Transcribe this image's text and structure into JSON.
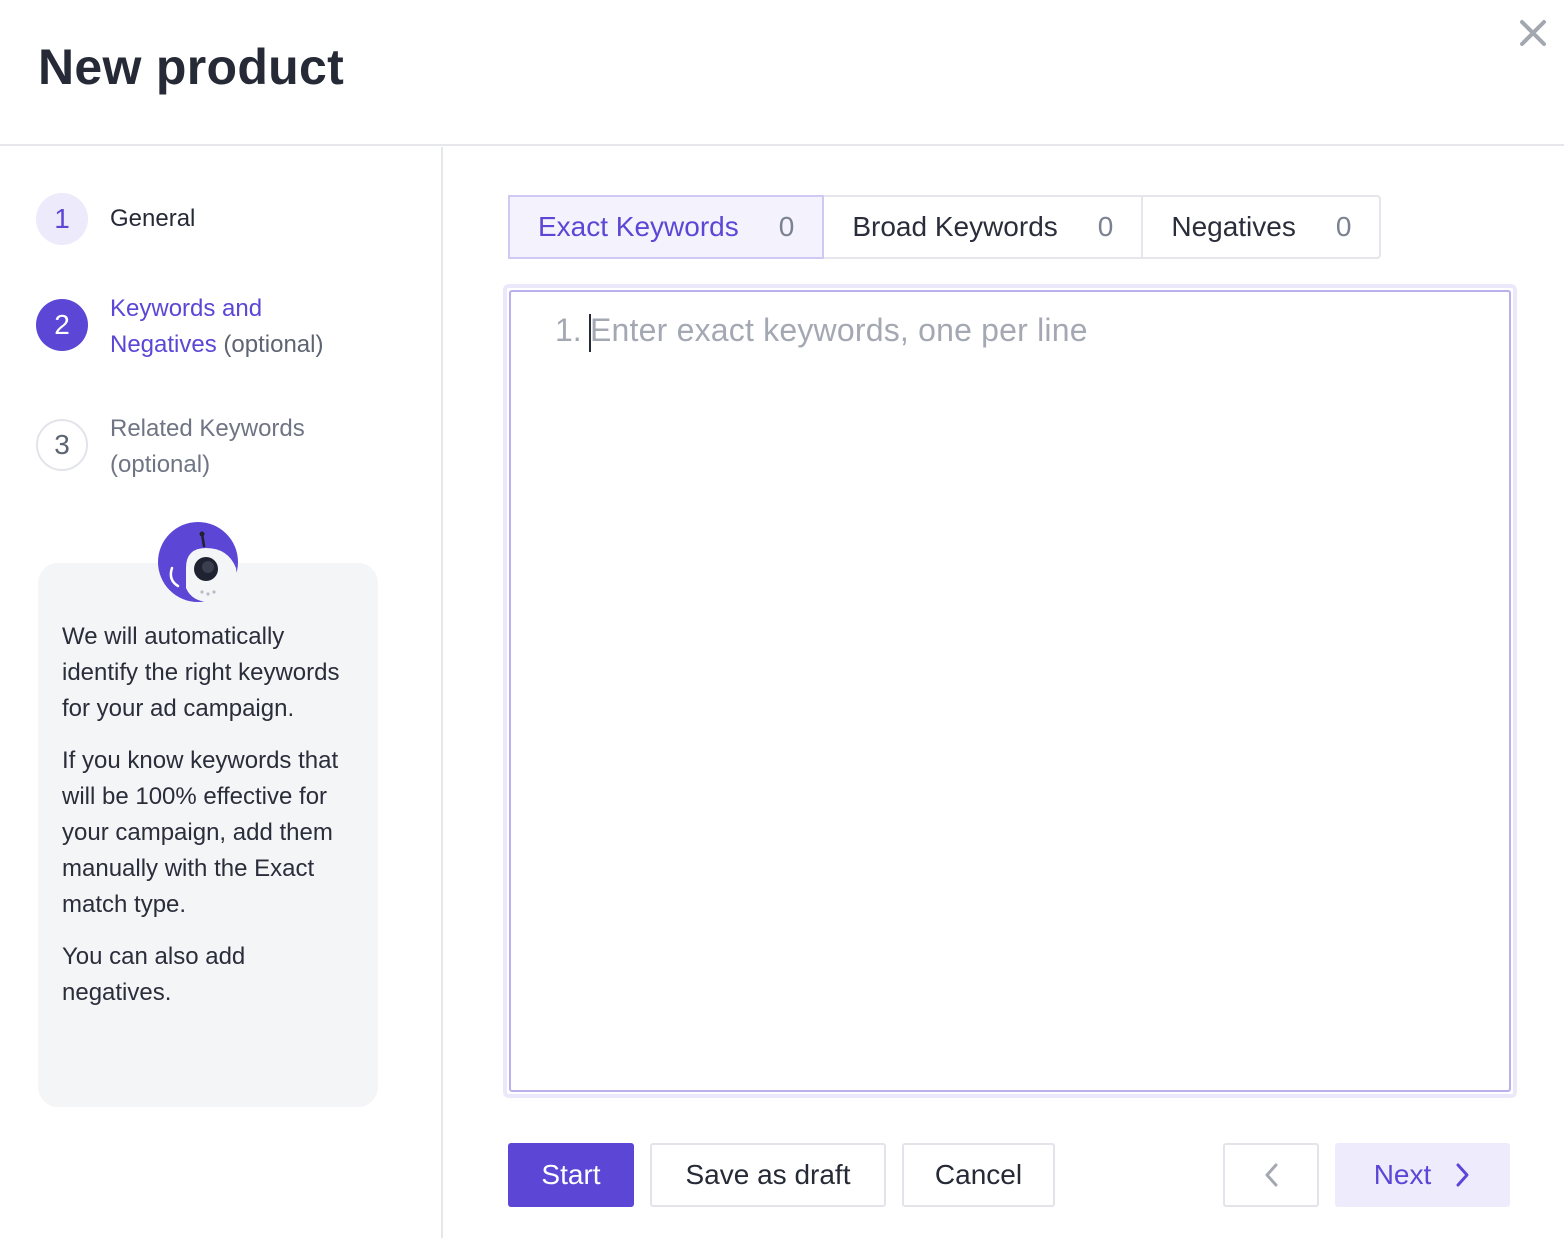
{
  "header": {
    "title": "New product",
    "close_icon": "close-icon"
  },
  "steps": [
    {
      "number": "1",
      "label": "General"
    },
    {
      "number": "2",
      "label_main": "Keywords and Negatives",
      "label_suffix": "(optional)"
    },
    {
      "number": "3",
      "label": "Related Keywords (optional)"
    }
  ],
  "info": {
    "avatar_icon": "robot-assistant-icon",
    "paragraphs": [
      "We will automatically identify the right keywords for your ad campaign.",
      "If you know keywords that will be 100% effective for your campaign, add them manually with the Exact match type.",
      "You can also add negatives."
    ]
  },
  "tabs": [
    {
      "label": "Exact Keywords",
      "count": "0",
      "active": true
    },
    {
      "label": "Broad Keywords",
      "count": "0",
      "active": false
    },
    {
      "label": "Negatives",
      "count": "0",
      "active": false
    }
  ],
  "editor": {
    "line_number": "1.",
    "placeholder": "Enter exact keywords, one per line"
  },
  "actions": {
    "start": "Start",
    "save_draft": "Save as draft",
    "cancel": "Cancel",
    "prev_icon": "chevron-left-icon",
    "next": "Next",
    "next_icon": "chevron-right-icon"
  },
  "colors": {
    "accent": "#5b46d6",
    "accent_light": "#eeecfc",
    "border": "#e2e4ea",
    "text": "#262a36",
    "muted": "#a3a8b3"
  }
}
